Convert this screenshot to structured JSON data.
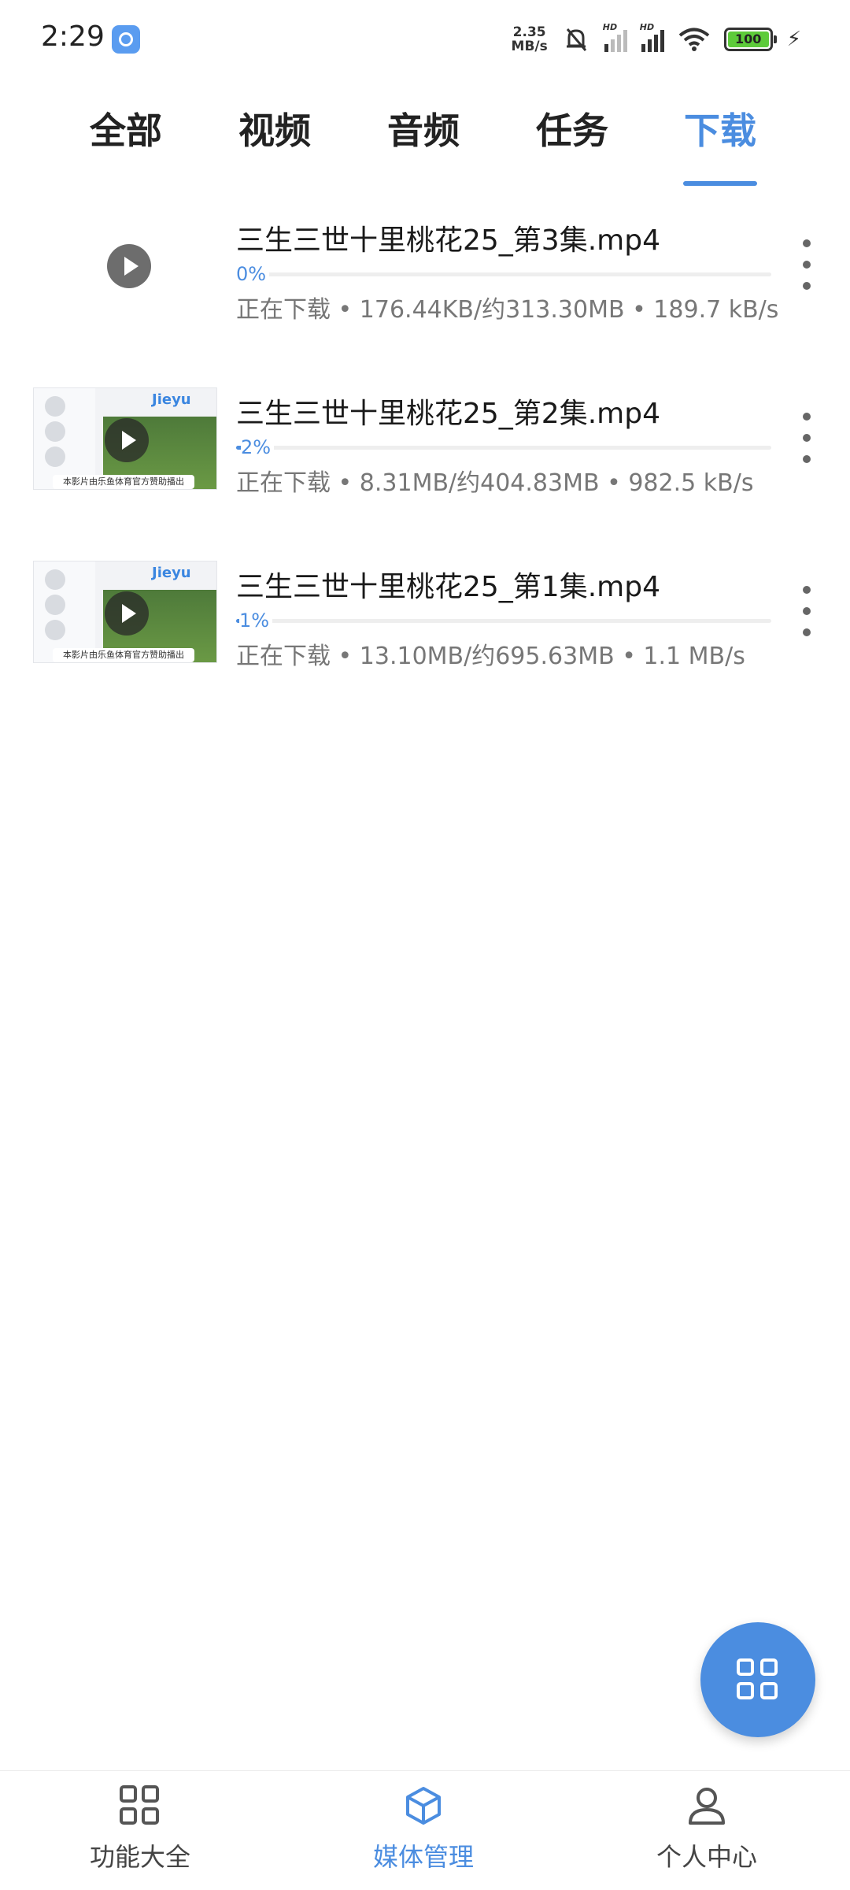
{
  "status_bar": {
    "time": "2:29",
    "net_speed_value": "2.35",
    "net_speed_unit": "MB/s",
    "signal_label": "HD",
    "battery": "100"
  },
  "tabs": [
    {
      "label": "全部",
      "active": false
    },
    {
      "label": "视频",
      "active": false
    },
    {
      "label": "音频",
      "active": false
    },
    {
      "label": "任务",
      "active": false
    },
    {
      "label": "下载",
      "active": true
    }
  ],
  "downloads": [
    {
      "title": "三生三世十里桃花25_第3集.mp4",
      "progress_label": "0%",
      "progress": 0,
      "status": "正在下载 • 176.44KB/约313.30MB • 189.7 kB/s"
    },
    {
      "title": "三生三世十里桃花25_第2集.mp4",
      "progress_label": "2%",
      "progress": 2,
      "status": "正在下载 • 8.31MB/约404.83MB • 982.5 kB/s",
      "thumb_brand": "Jieyu",
      "thumb_caption": "本影片由乐鱼体育官方赞助播出"
    },
    {
      "title": "三生三世十里桃花25_第1集.mp4",
      "progress_label": "1%",
      "progress": 1,
      "status": "正在下载 • 13.10MB/约695.63MB • 1.1 MB/s",
      "thumb_brand": "Jieyu",
      "thumb_caption": "本影片由乐鱼体育官方赞助播出"
    }
  ],
  "fab": {
    "icon": "grid-icon"
  },
  "bottom_nav": [
    {
      "label": "功能大全",
      "icon": "grid-icon",
      "active": false
    },
    {
      "label": "媒体管理",
      "icon": "cube-icon",
      "active": true
    },
    {
      "label": "个人中心",
      "icon": "person-icon",
      "active": false
    }
  ],
  "colors": {
    "accent": "#4b8de0"
  }
}
